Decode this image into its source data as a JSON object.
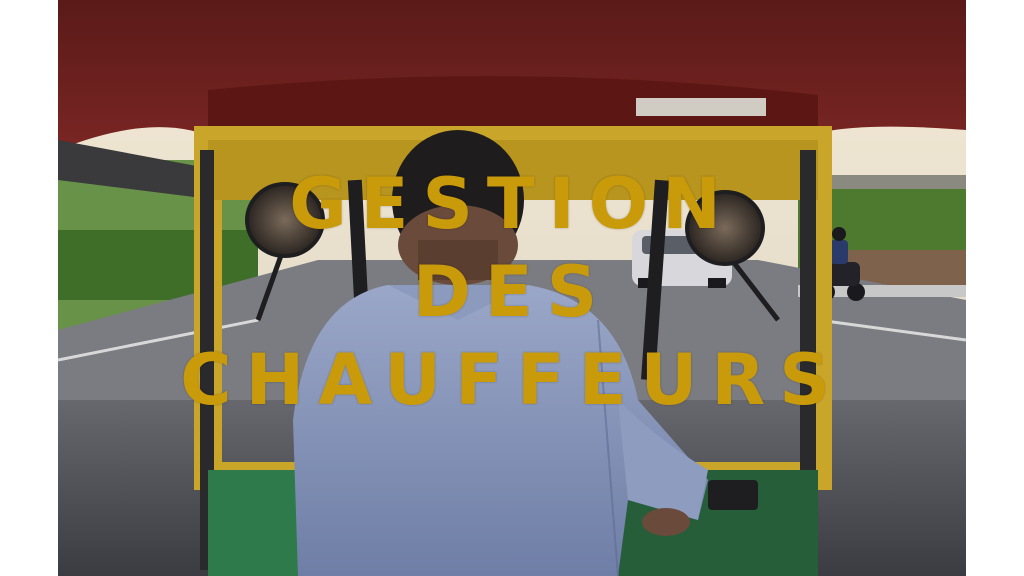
{
  "title": {
    "line1": "Gestion",
    "line2": "des",
    "line3": "chauffeurs"
  },
  "colors": {
    "title": "#c99a0a",
    "canopy": "#6e1e1c",
    "frame": "#c9a52a",
    "shirt": "#7f8fb5",
    "road": "#4a4c52",
    "dash": "#2f7a4a",
    "foliage": "#4d7a2e"
  },
  "photo_description_icons": [
    "auto-rickshaw-interior",
    "driver",
    "mirror-left",
    "mirror-right",
    "car",
    "motorcycle"
  ]
}
